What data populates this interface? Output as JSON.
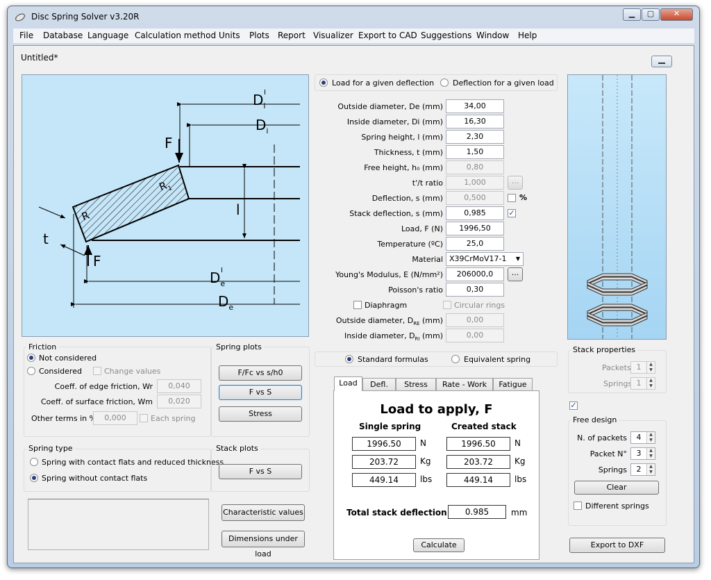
{
  "window": {
    "title": "Disc Spring Solver v3.20R",
    "min": "▁",
    "max": "▢",
    "close": "✕"
  },
  "menu": [
    "File",
    "Database",
    "Language",
    "Calculation method",
    "Units",
    "Plots",
    "Report",
    "Visualizer",
    "Export to CAD",
    "Suggestions",
    "Window",
    "Help"
  ],
  "document": {
    "title": "Untitled*"
  },
  "diagram": {
    "Di_prime": "D",
    "Di_prime_sup": "I",
    "Di_prime_sub": "i",
    "Di": "D",
    "Di_sub": "i",
    "F_top": "F",
    "F_bottom": "F",
    "R1": "R",
    "R1_sub": "1",
    "R": "R",
    "l": "l",
    "t": "t",
    "De_prime": "D",
    "De_prime_sup": "I",
    "De_prime_sub": "e",
    "De": "D",
    "De_sub": "e"
  },
  "mode": {
    "load_given_deflection": "Load for a given deflection",
    "deflection_given_load": "Deflection for a given load"
  },
  "params": [
    {
      "label": "Outside diameter, De (mm)",
      "value": "34,00"
    },
    {
      "label": "Inside diameter, Di (mm)",
      "value": "16,30"
    },
    {
      "label": "Spring height, l (mm)",
      "value": "2,30"
    },
    {
      "label": "Thickness, t (mm)",
      "value": "1,50"
    },
    {
      "label": "Free height, h₀ (mm)",
      "value": "0,80"
    },
    {
      "label": "t'/t ratio",
      "value": "1,000"
    },
    {
      "label": "Deflection, s (mm)",
      "value": "0,500"
    },
    {
      "label": "Stack deflection, s (mm)",
      "value": "0,985"
    },
    {
      "label": "Load, F (N)",
      "value": "1996,50"
    },
    {
      "label": "Temperature (ºC)",
      "value": "25,0"
    },
    {
      "label": "Material",
      "value": "X39CrMoV17-1"
    },
    {
      "label": "Young's Modulus, E (N/mm²)",
      "value": "206000,0"
    },
    {
      "label": "Poisson's ratio",
      "value": "0,30"
    }
  ],
  "ellipsis": "...",
  "percent": "%",
  "diaphragm": {
    "label": "Diaphragm",
    "circular": "Circular rings",
    "outside_label": "Outside diameter, D",
    "outside_sub": "RE",
    "outside_tail": " (mm)",
    "outside_value": "0,00",
    "inside_label": "Inside diameter, D",
    "inside_sub": "RI",
    "inside_tail": " (mm)",
    "inside_value": "0,00"
  },
  "formula": {
    "standard": "Standard formulas",
    "equivalent": "Equivalent spring"
  },
  "friction": {
    "title": "Friction",
    "not_considered": "Not considered",
    "considered": "Considered",
    "change_values": "Change values",
    "wr_label": "Coeff. of edge friction, Wr",
    "wr_value": "0,040",
    "wm_label": "Coeff. of surface friction, Wm",
    "wm_value": "0,020",
    "other_label": "Other terms in %",
    "other_value": "0,000",
    "each_spring": "Each spring"
  },
  "spring_plots": {
    "title": "Spring plots",
    "b1": "F/Fc vs s/h0",
    "b2": "F vs S",
    "b3": "Stress"
  },
  "spring_type": {
    "title": "Spring type",
    "opt1": "Spring with contact flats and reduced thickness",
    "opt2": "Spring without contact flats"
  },
  "stack_plots": {
    "title": "Stack plots",
    "b1": "F vs S"
  },
  "buttons": {
    "characteristic": "Characteristic values",
    "dimensions": "Dimensions under load",
    "calculate": "Calculate",
    "export_dxf": "Export to DXF",
    "clear": "Clear"
  },
  "tabs": [
    "Load",
    "Defl.",
    "Stress",
    "Rate - Work",
    "Fatigue"
  ],
  "results": {
    "heading": "Load to apply, F",
    "single": "Single spring",
    "created": "Created stack",
    "rows": [
      {
        "single": "1996.50",
        "stack": "1996.50",
        "unit": "N"
      },
      {
        "single": "203.72",
        "stack": "203.72",
        "unit": "Kg"
      },
      {
        "single": "449.14",
        "stack": "449.14",
        "unit": "lbs"
      }
    ],
    "total_label": "Total stack deflection",
    "total_value": "0.985",
    "total_unit": "mm"
  },
  "stack_props": {
    "title": "Stack properties",
    "packets_label": "Packets",
    "packets_value": "1",
    "springs_label": "Springs",
    "springs_value": "1"
  },
  "free_design": {
    "title": "Free design",
    "n_packets_label": "N. of packets",
    "n_packets_value": "4",
    "packet_n_label": "Packet N°",
    "packet_n_value": "3",
    "springs_label": "Springs",
    "springs_value": "2",
    "different": "Different springs"
  }
}
